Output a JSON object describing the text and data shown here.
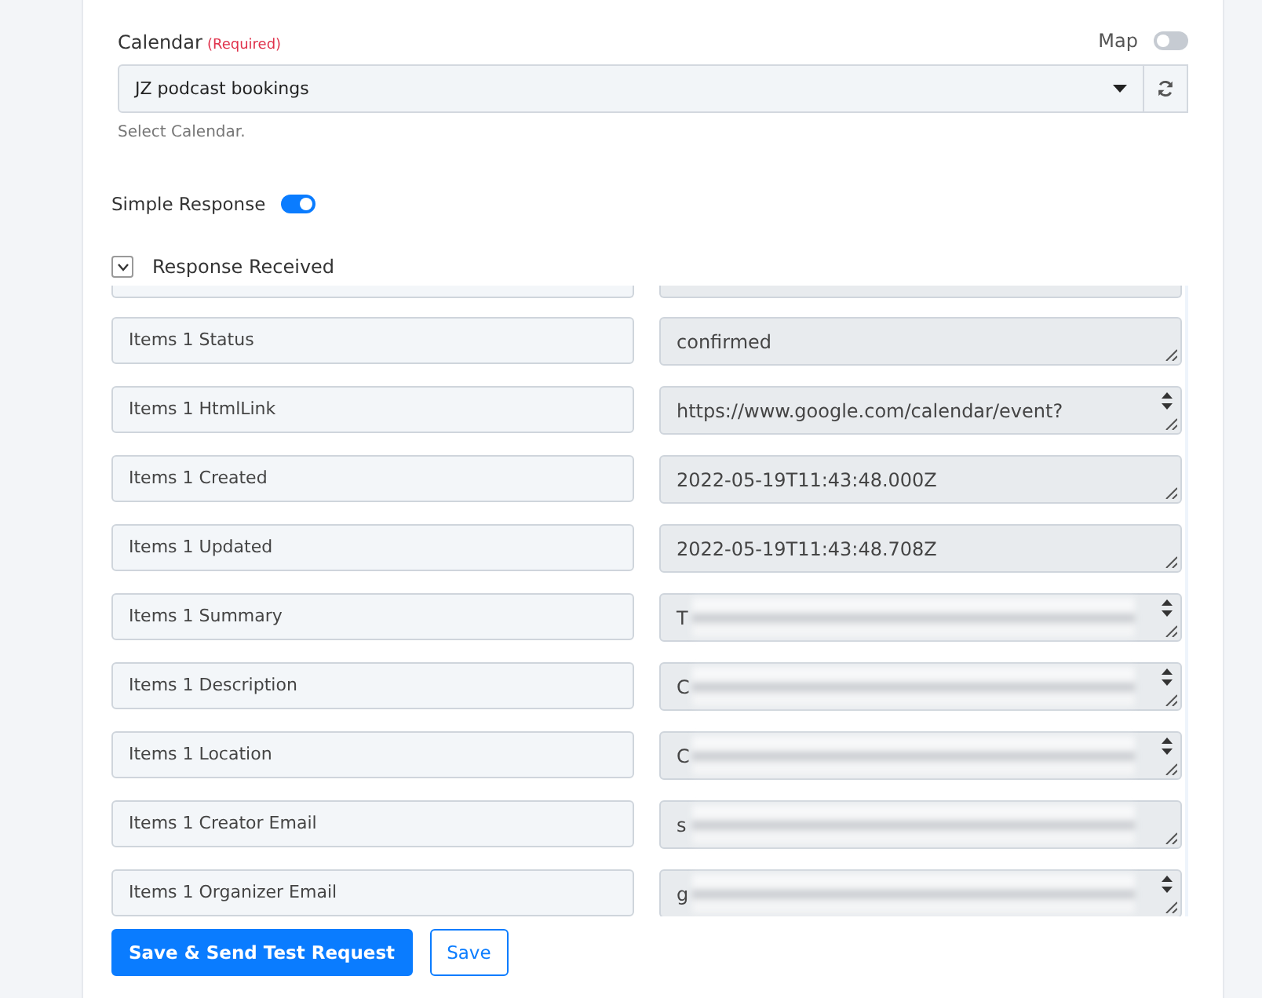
{
  "calendar": {
    "label": "Calendar",
    "required": "(Required)",
    "map_label": "Map",
    "map_on": false,
    "value": "JZ podcast bookings",
    "hint": "Select Calendar."
  },
  "simple_response": {
    "label": "Simple Response",
    "on": true
  },
  "response": {
    "title": "Response Received",
    "expanded": true,
    "rows": [
      {
        "label": "Items 1 Status",
        "value": "confirmed",
        "scrollable": false
      },
      {
        "label": "Items 1 HtmlLink",
        "value": "https://www.google.com/calendar/event?",
        "scrollable": true
      },
      {
        "label": "Items 1 Created",
        "value": "2022-05-19T11:43:48.000Z",
        "scrollable": false
      },
      {
        "label": "Items 1 Updated",
        "value": "2022-05-19T11:43:48.708Z",
        "scrollable": false
      },
      {
        "label": "Items 1 Summary",
        "value": "T",
        "scrollable": true,
        "redacted": true
      },
      {
        "label": "Items 1 Description",
        "value": "C",
        "scrollable": true,
        "redacted": true
      },
      {
        "label": "Items 1 Location",
        "value": "C",
        "scrollable": true,
        "redacted": true
      },
      {
        "label": "Items 1 Creator Email",
        "value": "s",
        "scrollable": false,
        "redacted": true
      },
      {
        "label": "Items 1 Organizer Email",
        "value": "g",
        "scrollable": true,
        "redacted": true
      }
    ]
  },
  "buttons": [
    {
      "label": "Save & Send Test Request",
      "kind": "primary"
    },
    {
      "label": "Save",
      "kind": "secondary"
    }
  ]
}
